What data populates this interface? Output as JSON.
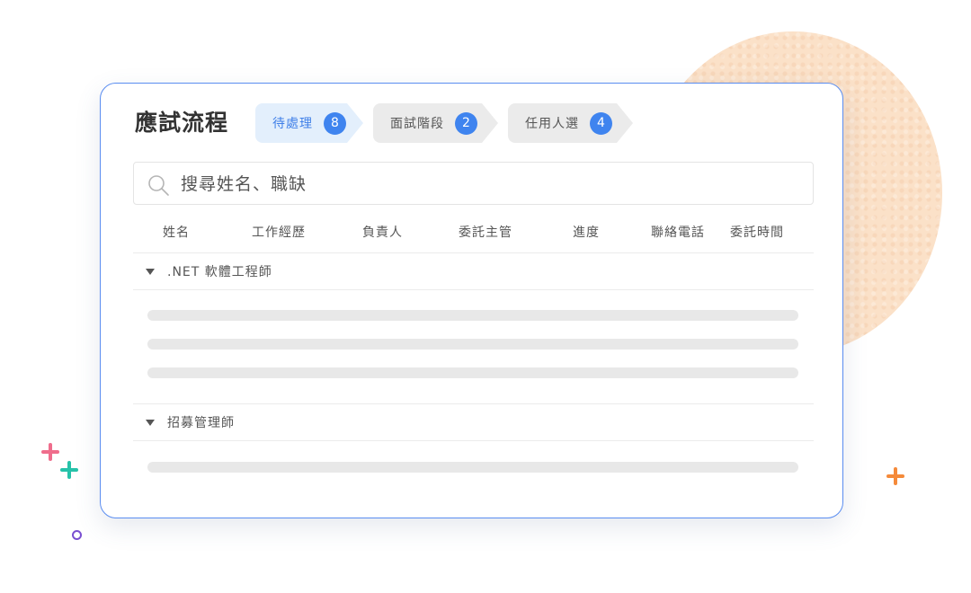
{
  "page": {
    "title": "應試流程",
    "steps": [
      {
        "label": "待處理",
        "count": "8",
        "active": true
      },
      {
        "label": "面試階段",
        "count": "2",
        "active": false
      },
      {
        "label": "任用人選",
        "count": "4",
        "active": false
      }
    ],
    "search": {
      "placeholder": "搜尋姓名、職缺",
      "icon": "search-icon"
    },
    "columns": [
      "姓名",
      "工作經歷",
      "負責人",
      "委託主管",
      "進度",
      "聯絡電話",
      "委託時間"
    ],
    "groups": [
      {
        "label": ".NET 軟體工程師",
        "expanded": true,
        "icon": "caret-down-icon"
      },
      {
        "label": "招募管理師",
        "expanded": true,
        "icon": "caret-down-icon"
      }
    ]
  },
  "colors": {
    "accent": "#3f84ef",
    "card_border": "#5a8df0",
    "active_step_bg": "#e3effc",
    "inactive_step_bg": "#ebebeb",
    "decor_circle": "#fbe1c8",
    "decor_pink": "#ef6d8c",
    "decor_teal": "#26c2a9",
    "decor_orange": "#f58a3a",
    "decor_purple": "#7a4fd1"
  }
}
